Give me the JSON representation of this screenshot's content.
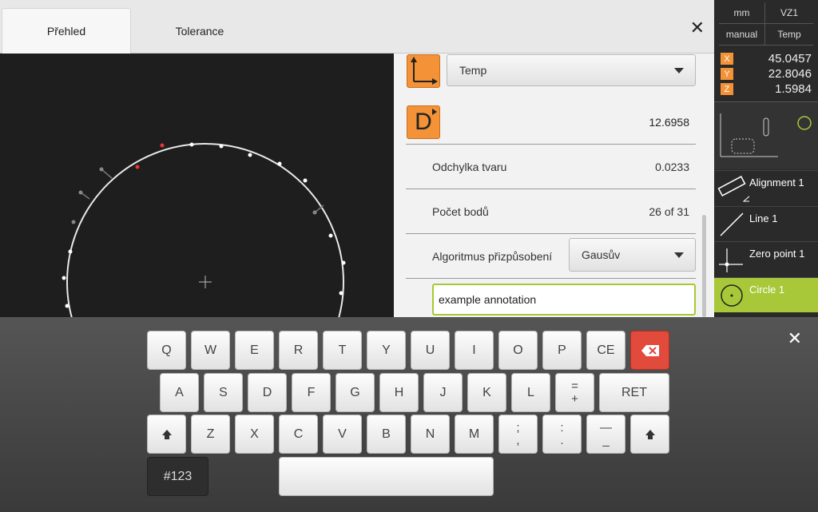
{
  "tabs": {
    "overview": "Přehled",
    "tolerance": "Tolerance",
    "close": "✕"
  },
  "details": {
    "reference_dropdown": "Temp",
    "diameter_value": "12.6958",
    "form_deviation": {
      "label": "Odchylka tvaru",
      "value": "0.0233"
    },
    "point_count": {
      "label": "Počet bodů",
      "value": "26 of 31"
    },
    "fit_algorithm": {
      "label": "Algoritmus přizpůsobení",
      "value": "Gausův"
    },
    "annotation": "example annotation",
    "diameter_letter": "D"
  },
  "sidebar": {
    "unit": "mm",
    "vz": "VZ1",
    "mode": "manual",
    "temp": "Temp",
    "axes": [
      {
        "axis": "X",
        "value": "45.0457"
      },
      {
        "axis": "Y",
        "value": "22.8046"
      },
      {
        "axis": "Z",
        "value": "1.5984"
      }
    ],
    "features": [
      {
        "label": "Alignment 1"
      },
      {
        "label": "Line 1"
      },
      {
        "label": "Zero point 1"
      },
      {
        "label": "Circle 1"
      }
    ]
  },
  "keyboard": {
    "row1": [
      "Q",
      "W",
      "E",
      "R",
      "T",
      "Y",
      "U",
      "I",
      "O",
      "P",
      "CE"
    ],
    "row2": [
      "A",
      "S",
      "D",
      "F",
      "G",
      "H",
      "J",
      "K",
      "L"
    ],
    "row2_eq_top": "=",
    "row2_eq_bottom": "+",
    "ret": "RET",
    "row3": [
      "Z",
      "X",
      "C",
      "V",
      "B",
      "N",
      "M"
    ],
    "semi_top": ";",
    "semi_bottom": ",",
    "colon_top": ":",
    "colon_bottom": ".",
    "dash_top": "—",
    "dash_bottom": "_",
    "numeric": "#123",
    "close": "✕"
  },
  "colors": {
    "accent_orange": "#f39237",
    "active_green": "#a8c83a",
    "backspace_red": "#e24a3b"
  }
}
